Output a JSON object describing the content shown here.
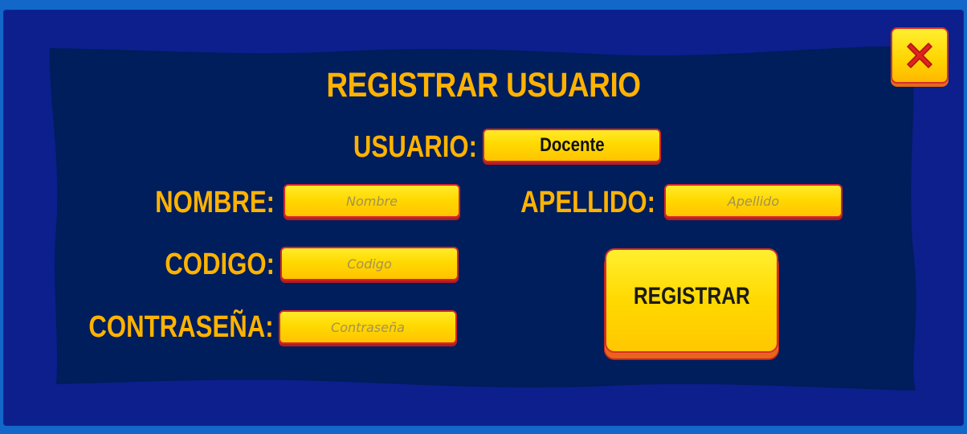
{
  "dialog": {
    "title": "REGISTRAR USUARIO"
  },
  "form": {
    "usuario": {
      "label": "USUARIO:",
      "value": "Docente"
    },
    "nombre": {
      "label": "NOMBRE:",
      "placeholder": "Nombre"
    },
    "apellido": {
      "label": "APELLIDO:",
      "placeholder": "Apellido"
    },
    "codigo": {
      "label": "CODIGO:",
      "placeholder": "Codigo"
    },
    "contrasena": {
      "label": "CONTRASEÑA:",
      "placeholder": "Contraseña"
    }
  },
  "buttons": {
    "register_label": "REGISTRAR",
    "close_icon": "close-x-icon"
  },
  "colors": {
    "label": "#ffb300",
    "field": "#ffd900",
    "field_border": "#d7262b",
    "panel": "#0c1f8c",
    "inner_panel": "#001d5c",
    "close_x": "#e0221f"
  }
}
